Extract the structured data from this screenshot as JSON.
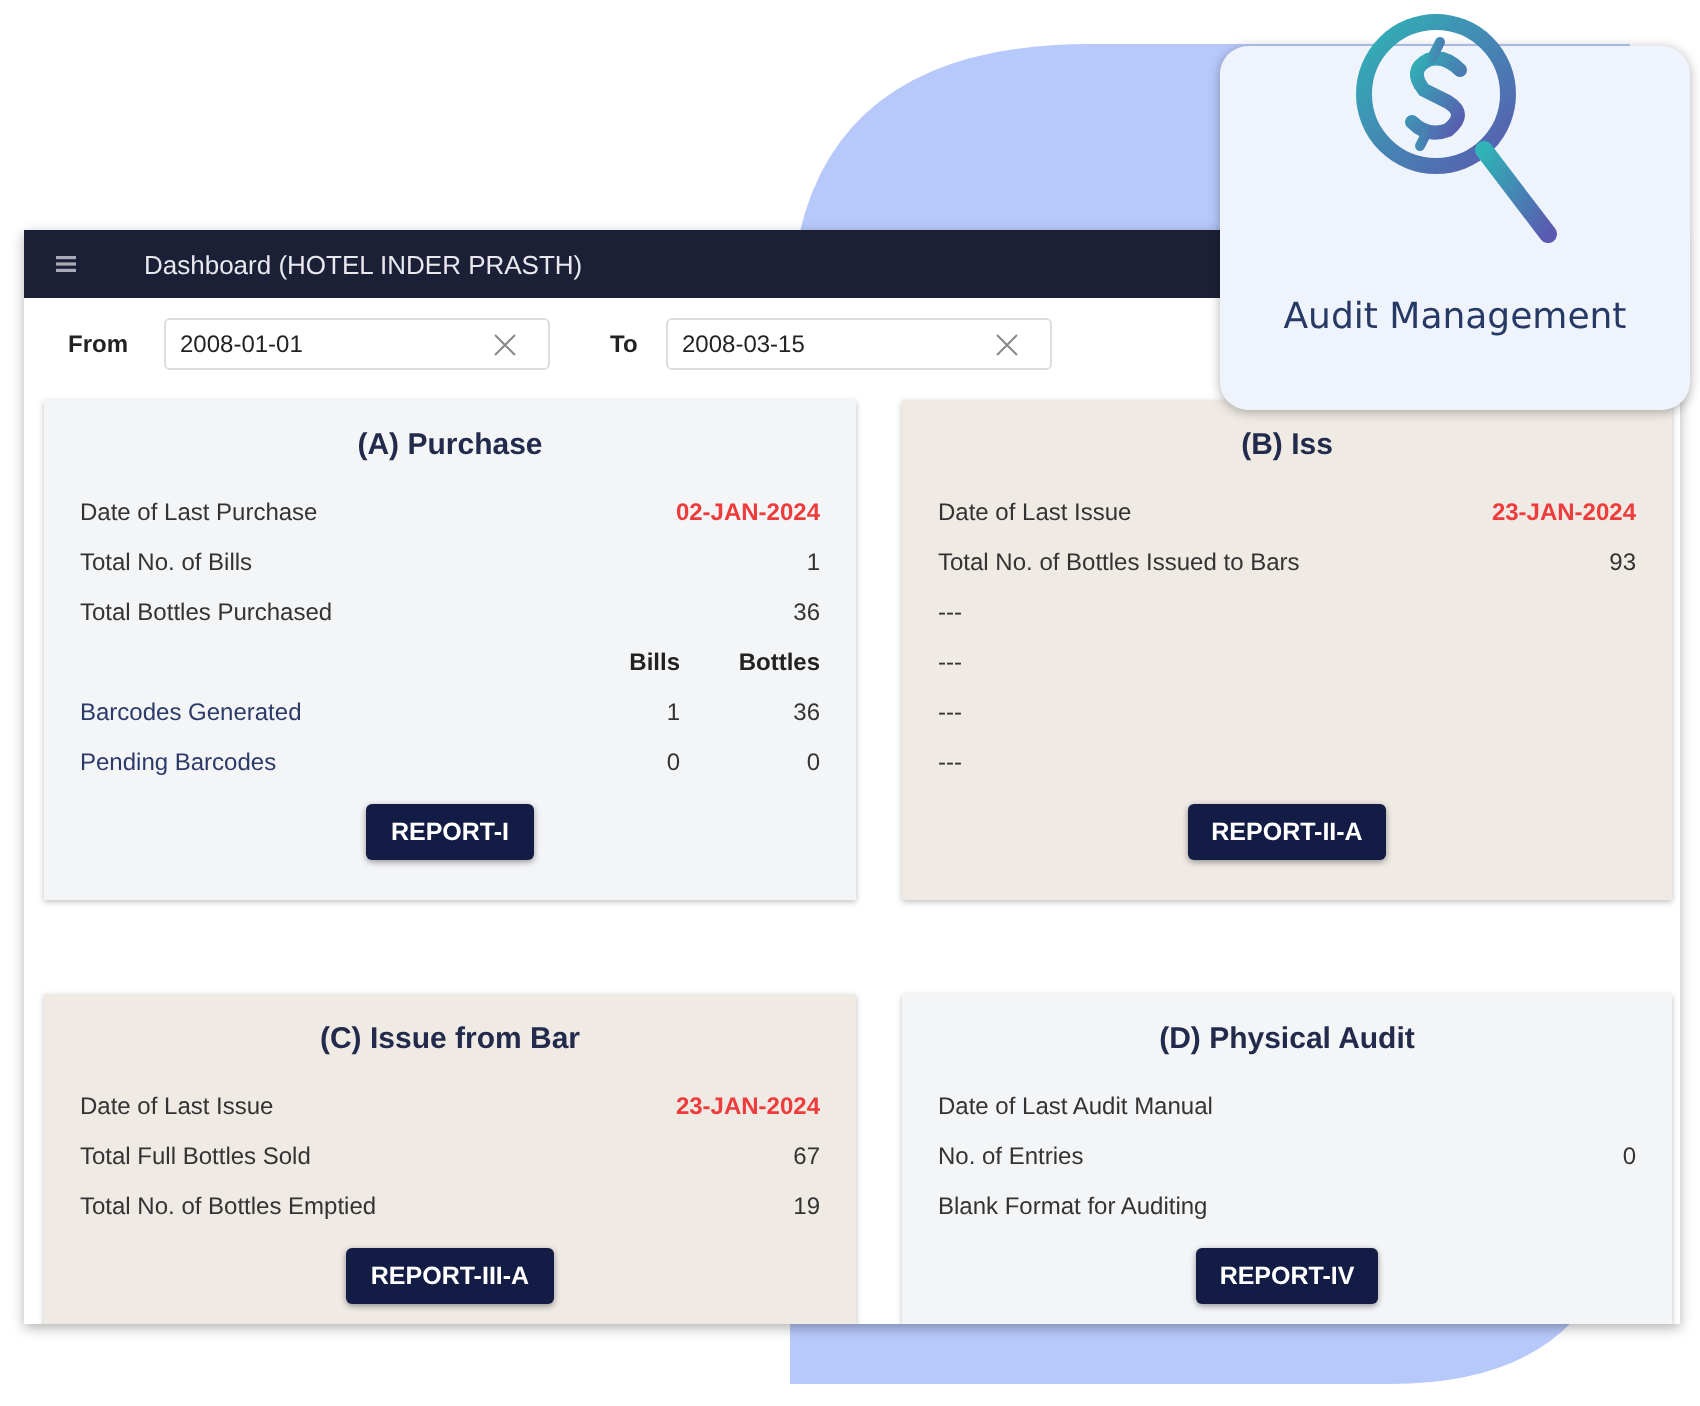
{
  "header": {
    "title": "Dashboard (HOTEL INDER PRASTH)"
  },
  "filters": [
    {
      "label": "From",
      "value": "2008-01-01"
    },
    {
      "label": "To",
      "value": "2008-03-15"
    }
  ],
  "cards": [
    {
      "title": "(A) Purchase",
      "color": "#f4f5f7",
      "button": "REPORT-I",
      "rows": [
        {
          "kind": "single",
          "label": "Date of Last Purchase",
          "value": "02-JAN-2024",
          "highlight": true
        },
        {
          "kind": "single",
          "label": "Total No. of Bills",
          "value": "1",
          "highlight": false
        },
        {
          "kind": "single",
          "label": "Total Bottles Purchased",
          "value": "36",
          "highlight": false
        },
        {
          "kind": "heading",
          "values": [
            "Bills",
            "Bottles"
          ]
        },
        {
          "kind": "pair",
          "label": "Barcodes Generated",
          "values": [
            "1",
            "36"
          ]
        },
        {
          "kind": "pair",
          "label": "Pending Barcodes",
          "values": [
            "0",
            "0"
          ]
        }
      ]
    },
    {
      "title": "(B) Iss",
      "color": "#efeae4",
      "button": "REPORT-II-A",
      "rows": [
        {
          "kind": "single",
          "label": "Date of Last Issue",
          "value": "23-JAN-2024",
          "highlight": true
        },
        {
          "kind": "single",
          "label": "Total No. of Bottles Issued to Bars",
          "value": "93",
          "highlight": false
        },
        {
          "kind": "single",
          "label": "---"
        },
        {
          "kind": "single",
          "label": "---"
        },
        {
          "kind": "single",
          "label": "---"
        },
        {
          "kind": "single",
          "label": "---"
        }
      ]
    },
    {
      "title": "(C) Issue from Bar",
      "color": "#efeae4",
      "button": "REPORT-III-A",
      "rows": [
        {
          "kind": "single",
          "label": "Date of Last Issue",
          "value": "23-JAN-2024",
          "highlight": true
        },
        {
          "kind": "single",
          "label": "Total Full Bottles Sold",
          "value": "67",
          "highlight": false
        },
        {
          "kind": "single",
          "label": "Total No. of Bottles Emptied",
          "value": "19",
          "highlight": false
        }
      ]
    },
    {
      "title": "(D) Physical Audit",
      "color": "#f4f5f7",
      "button": "REPORT-IV",
      "rows": [
        {
          "kind": "single",
          "label": "Date of Last Audit Manual"
        },
        {
          "kind": "single",
          "label": "No. of Entries",
          "value": "0",
          "highlight": false
        },
        {
          "kind": "single",
          "label": "Blank Format for Auditing"
        }
      ]
    }
  ],
  "feature_card": {
    "title": "Audit Management"
  }
}
